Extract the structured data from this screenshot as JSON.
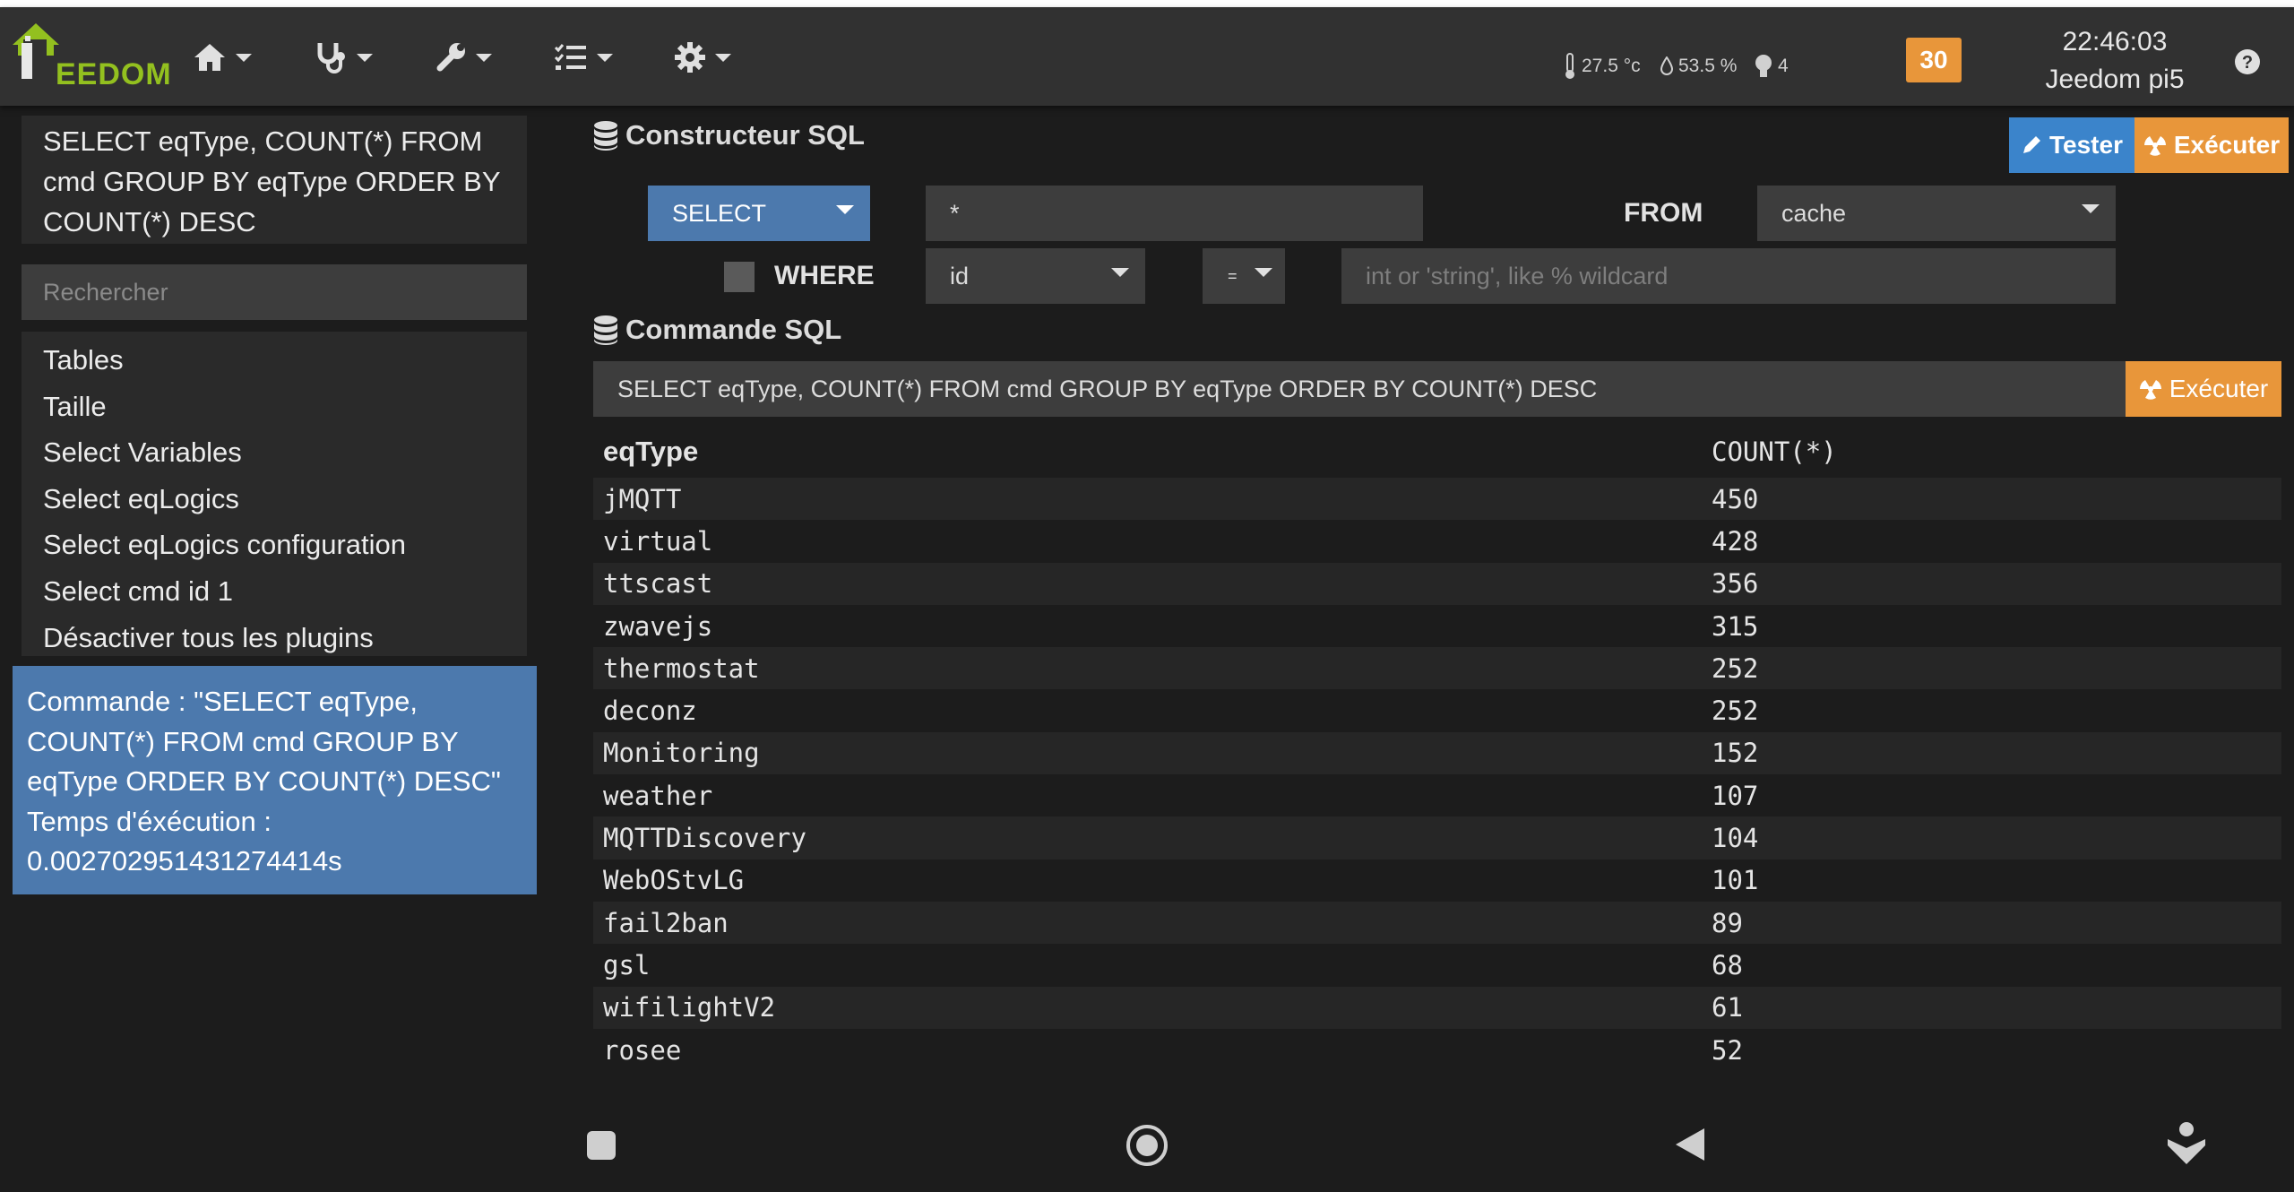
{
  "header": {
    "logo_text_prefix": "J",
    "logo_text_rest": "EEDOM",
    "temperature": "27.5 °c",
    "humidity": "53.5 %",
    "lights": "4",
    "notifications": "30",
    "time": "22:46:03",
    "host": "Jeedom pi5",
    "nav_icons": [
      "home-icon",
      "stethoscope-icon",
      "wrench-icon",
      "tasks-icon",
      "gear-icon"
    ]
  },
  "sidebar": {
    "current_query": "SELECT eqType, COUNT(*) FROM cmd GROUP BY eqType ORDER BY COUNT(*) DESC",
    "search_placeholder": "Rechercher",
    "items": [
      "Tables",
      "Taille",
      "Select Variables",
      "Select eqLogics",
      "Select eqLogics configuration",
      "Select cmd id 1",
      "Désactiver tous les plugins"
    ],
    "result_info": "Commande : \"SELECT eqType, COUNT(*) FROM cmd GROUP BY eqType ORDER BY COUNT(*) DESC\" Temps d'éxécution : 0.002702951431274414s"
  },
  "builder": {
    "title": "Constructeur SQL",
    "tester_label": "Tester",
    "execute_label": "Exécuter",
    "select_value": "SELECT",
    "columns_value": "*",
    "from_label": "FROM",
    "from_value": "cache",
    "where_label": "WHERE",
    "where_field": "id",
    "where_operator": "=",
    "where_value_placeholder": "int or 'string', like % wildcard"
  },
  "command": {
    "title": "Commande SQL",
    "value": "SELECT eqType, COUNT(*) FROM cmd GROUP BY eqType ORDER BY COUNT(*) DESC",
    "execute_label": "Exécuter"
  },
  "results": {
    "columns": [
      "eqType",
      "COUNT(*)"
    ],
    "rows": [
      [
        "jMQTT",
        "450"
      ],
      [
        "virtual",
        "428"
      ],
      [
        "ttscast",
        "356"
      ],
      [
        "zwavejs",
        "315"
      ],
      [
        "thermostat",
        "252"
      ],
      [
        "deconz",
        "252"
      ],
      [
        "Monitoring",
        "152"
      ],
      [
        "weather",
        "107"
      ],
      [
        "MQTTDiscovery",
        "104"
      ],
      [
        "WebOStvLG",
        "101"
      ],
      [
        "fail2ban",
        "89"
      ],
      [
        "gsl",
        "68"
      ],
      [
        "wifilightV2",
        "61"
      ],
      [
        "rosee",
        "52"
      ]
    ]
  },
  "colors": {
    "accent_blue": "#4c79ad",
    "tester_blue": "#3b84cb",
    "execute_orange": "#e8963a",
    "logo_green": "#93c01f"
  }
}
